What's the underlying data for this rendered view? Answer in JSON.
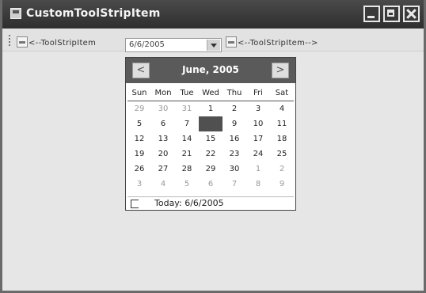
{
  "window": {
    "title": "CustomToolStripItem"
  },
  "toolstrip": {
    "left_label": "<--ToolStripItem",
    "date_value": "6/6/2005",
    "right_label": "<--ToolStripItem-->"
  },
  "calendar": {
    "title": "June, 2005",
    "prev_label": "<",
    "next_label": ">",
    "weekdays": [
      "Sun",
      "Mon",
      "Tue",
      "Wed",
      "Thu",
      "Fri",
      "Sat"
    ],
    "weeks": [
      [
        "29",
        "30",
        "31",
        "1",
        "2",
        "3",
        "4"
      ],
      [
        "5",
        "6",
        "7",
        "8",
        "9",
        "10",
        "11"
      ],
      [
        "12",
        "13",
        "14",
        "15",
        "16",
        "17",
        "18"
      ],
      [
        "19",
        "20",
        "21",
        "22",
        "23",
        "24",
        "25"
      ],
      [
        "26",
        "27",
        "28",
        "29",
        "30",
        "1",
        "2"
      ],
      [
        "3",
        "4",
        "5",
        "6",
        "7",
        "8",
        "9"
      ]
    ],
    "selected_day": "8",
    "today_label": "Today: 6/6/2005"
  },
  "colors": {
    "titlebar": "#3a3a3a",
    "client_area": "#e6e6e6",
    "calendar_header": "#5a5a5a",
    "selected_day": "#505050"
  }
}
